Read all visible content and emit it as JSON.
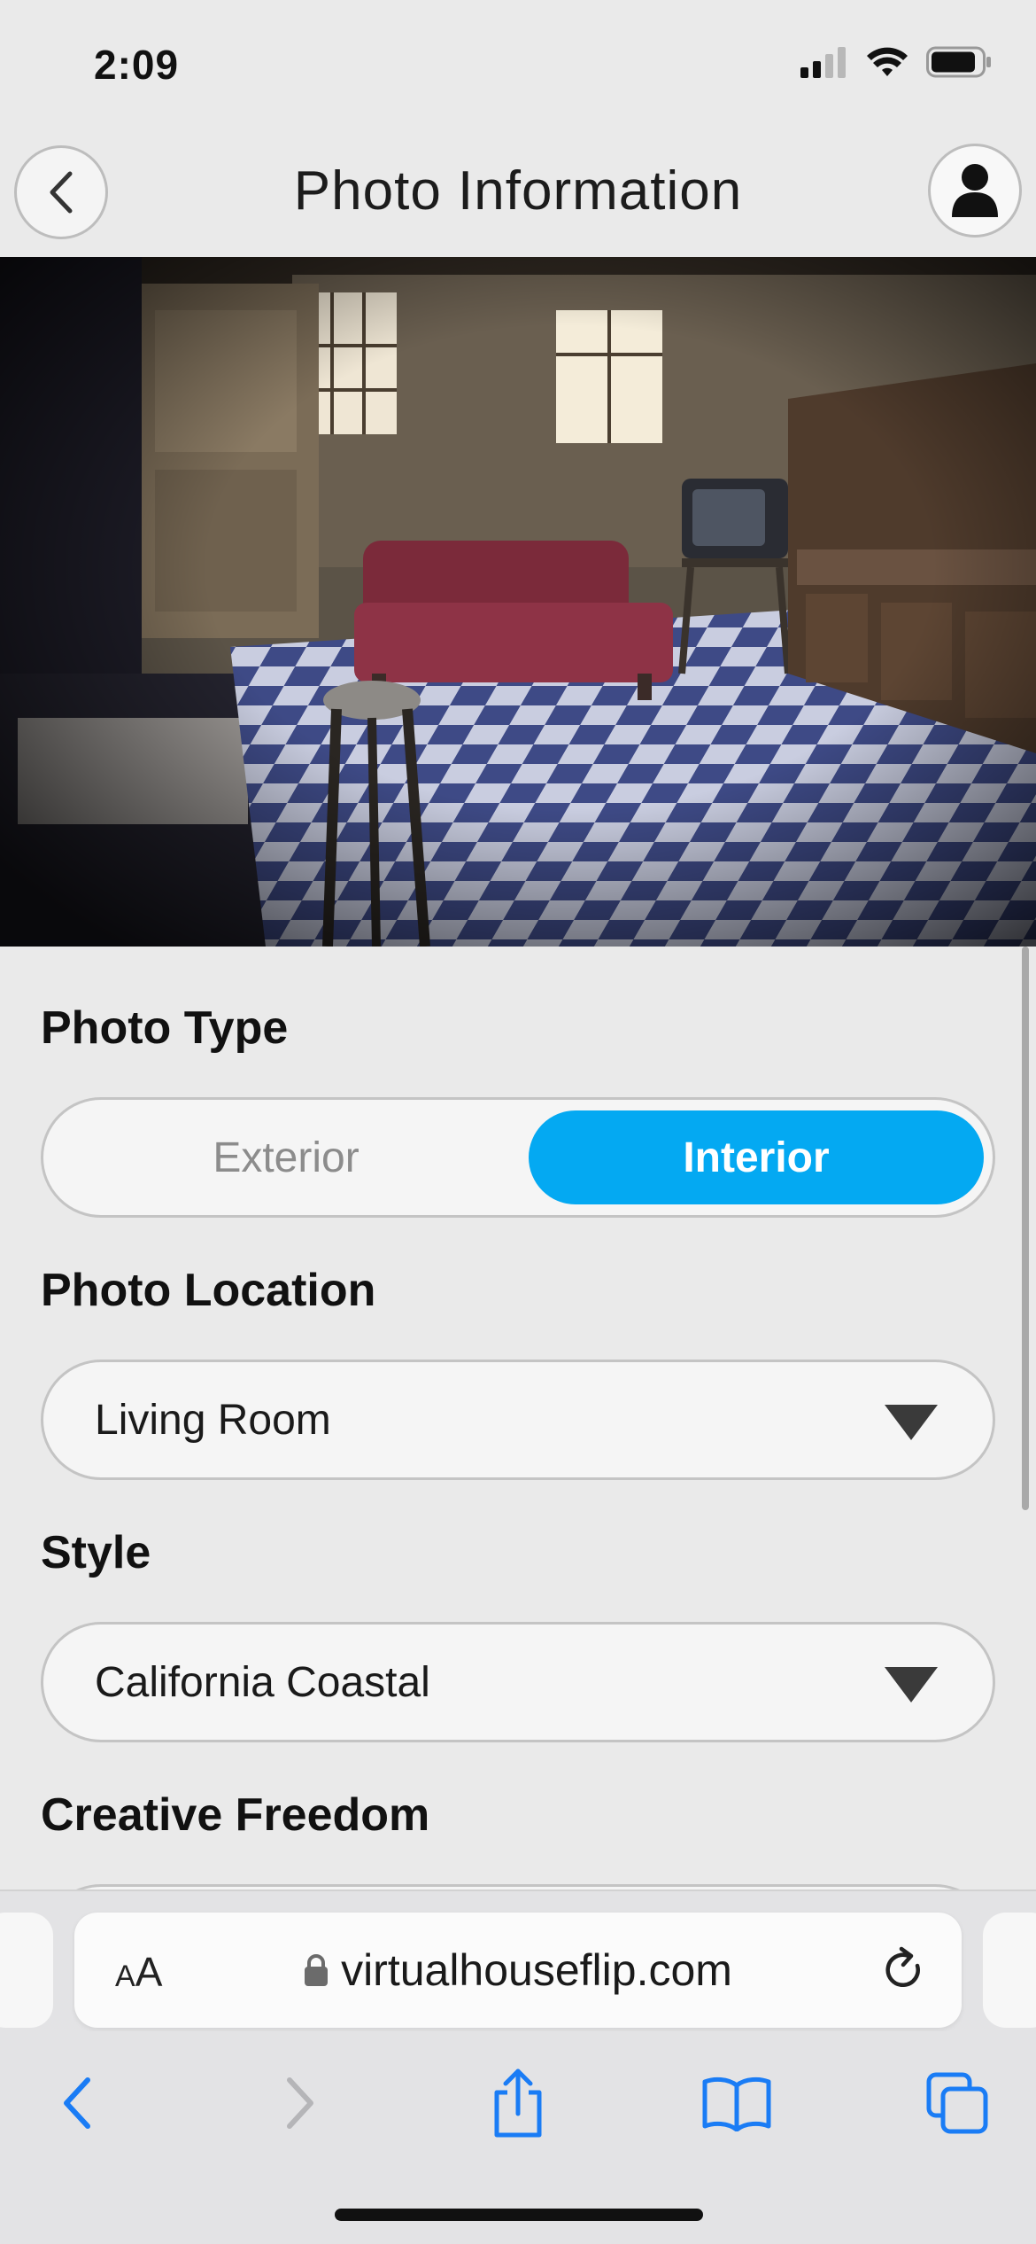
{
  "status_bar": {
    "time": "2:09",
    "icons": [
      "signal-icon",
      "wifi-icon",
      "battery-icon"
    ]
  },
  "header": {
    "title": "Photo Information",
    "back_icon": "chevron-left-icon",
    "profile_icon": "person-icon"
  },
  "photo": {
    "alt": "Abandoned living room with checkered floor, red couch, old TV and wooden cabinets"
  },
  "form": {
    "photo_type": {
      "label": "Photo Type",
      "options": [
        "Exterior",
        "Interior"
      ],
      "selected": "Interior"
    },
    "photo_location": {
      "label": "Photo Location",
      "value": "Living Room"
    },
    "style": {
      "label": "Style",
      "value": "California Coastal"
    },
    "creative_freedom": {
      "label": "Creative Freedom"
    }
  },
  "browser": {
    "aa_label_small": "A",
    "aa_label_large": "A",
    "url": "virtualhouseflip.com",
    "toolbar_icons": [
      "back-arrow-icon",
      "forward-arrow-icon",
      "share-icon",
      "bookmarks-icon",
      "tabs-icon"
    ]
  },
  "colors": {
    "accent": "#04a9f2",
    "ios_blue": "#1a7cf5",
    "background": "#eaeaea"
  }
}
